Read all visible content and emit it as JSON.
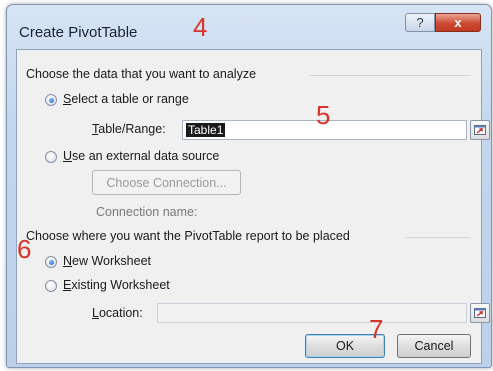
{
  "window": {
    "title": "Create PivotTable",
    "help_label": "?",
    "close_label": "x"
  },
  "source_group": {
    "heading": "Choose the data that you want to analyze",
    "option_table": {
      "key": "S",
      "rest": "elect a table or range",
      "checked": true
    },
    "table_range_label": {
      "key": "T",
      "rest": "able/Range:"
    },
    "table_range_value": "Table1",
    "option_external": {
      "key": "U",
      "rest": "se an external data source",
      "checked": false
    },
    "choose_connection_label": "Choose Connection...",
    "connection_name_label": "Connection name:"
  },
  "placement_group": {
    "heading": "Choose where you want the PivotTable report to be placed",
    "option_new": {
      "key": "N",
      "rest": "ew Worksheet",
      "checked": true
    },
    "option_existing": {
      "key": "E",
      "rest": "xisting Worksheet",
      "checked": false
    },
    "location_label": {
      "key": "L",
      "rest": "ocation:"
    },
    "location_value": ""
  },
  "buttons": {
    "ok": "OK",
    "cancel": "Cancel"
  },
  "annotations": {
    "n4": "4",
    "n5": "5",
    "n6": "6",
    "n7": "7"
  },
  "colors": {
    "annotation": "#d9342b",
    "selection_bg": "#1a1a1a",
    "radio_dot": "#1c5fb8"
  },
  "icons": {
    "collapse": "range-collapse-icon",
    "help": "help-icon",
    "close": "close-icon"
  }
}
